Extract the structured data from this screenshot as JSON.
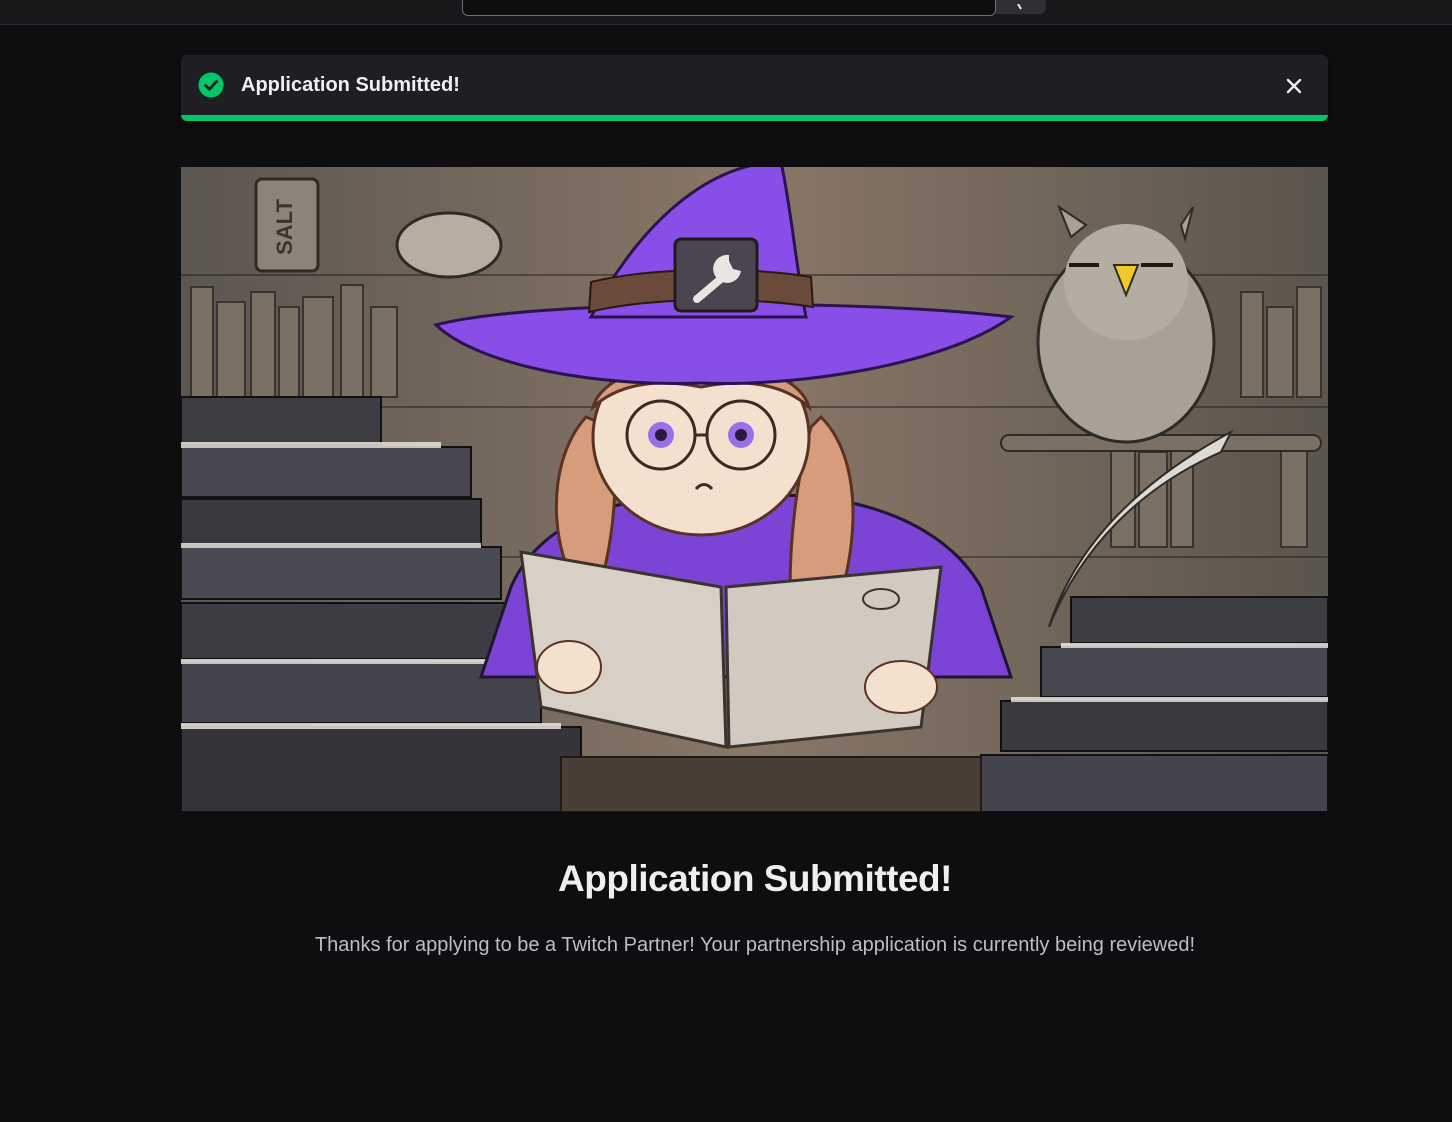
{
  "header": {
    "search": {
      "value": "",
      "button_icon": "search-icon"
    }
  },
  "toast": {
    "message": "Application Submitted!",
    "status_icon": "check-circle-icon",
    "close_icon": "close-icon",
    "progress": 1.0,
    "accent_color": "#00c768"
  },
  "illustration": {
    "subject": "witch reading a book in a library with an owl",
    "jar_label": "SALT",
    "hat_badge_icon": "wrench-icon"
  },
  "main": {
    "title": "Application Submitted!",
    "message": "Thanks for applying to be a Twitch Partner! Your partnership application is currently being reviewed!"
  },
  "colors": {
    "background": "#0e0e10",
    "brand_purple": "#9147ff",
    "success": "#00c768"
  }
}
